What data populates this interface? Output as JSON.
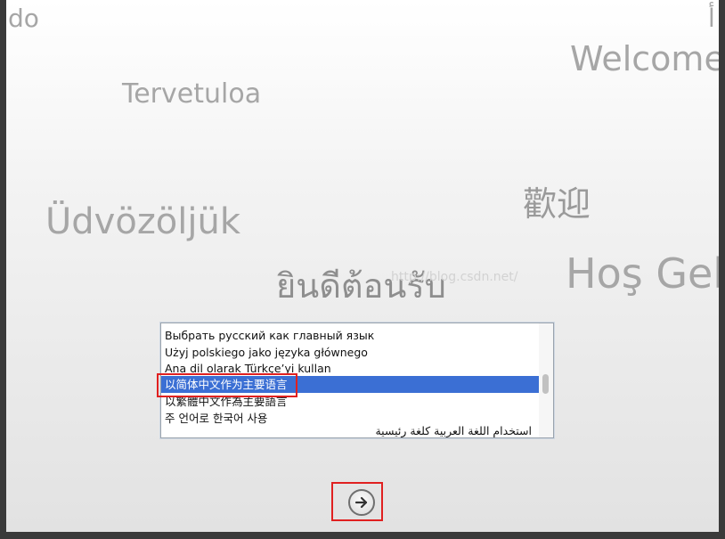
{
  "greetings": {
    "do": "do",
    "arabic_top": "أ",
    "welcome": "Welcome",
    "tervetuloa": "Tervetuloa",
    "huanying": "歡迎",
    "udvozoljuk": "Üdvözöljük",
    "thai": "ยินดีต้อนรับ",
    "hosgel": "Hoş Gel"
  },
  "watermark": "http://blog.csdn.net/",
  "language_list": {
    "items": [
      "Выбрать русский как главный язык",
      "Użyj polskiego jako języka głównego",
      "Ana dil olarak Türkçe’yi kullan",
      "以简体中文作为主要语言",
      "以繁體中文作為主要語言",
      "주 언어로 한국어 사용"
    ],
    "partial_last_item": "استخدام اللغة العربية كلغة رئيسية",
    "selected_index": 3
  },
  "colors": {
    "selection": "#3b6fd4",
    "annotation_box": "#e02020",
    "greeting_text": "#a6a6a6"
  },
  "continue_button": {
    "icon": "arrow-right-circle-icon"
  }
}
